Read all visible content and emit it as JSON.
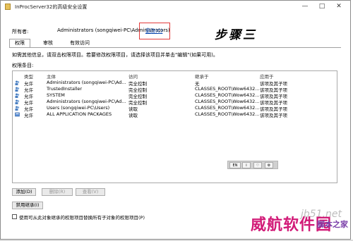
{
  "window": {
    "title": "InProcServer32的高级安全设置",
    "minimize_glyph": "—",
    "maximize_glyph": "□",
    "close_glyph": "✕"
  },
  "owner": {
    "label": "所有者:",
    "value": "Administrators (songqiwei-PC\\Administrators)",
    "change_link": "更改(C)"
  },
  "annotation": {
    "step_text": "步骤三",
    "highlight_color": "#e23a3a"
  },
  "tabs": [
    {
      "label": "权限",
      "active": true
    },
    {
      "label": "审核",
      "active": false
    },
    {
      "label": "有效访问",
      "active": false
    }
  ],
  "info_text": "如需其他信息，请双击权限项目。若要修改权限项目，请选择该项目并单击\"编辑\"(如果可用)。",
  "entries_label": "权限条目:",
  "table": {
    "headers": [
      "类型",
      "主体",
      "访问",
      "继承于",
      "应用于"
    ],
    "rows": [
      [
        "允许",
        "Administrators (songqiwei-PC\\Ad...",
        "完全控制",
        "无",
        "该项及其子项"
      ],
      [
        "允许",
        "TrustedInstaller",
        "完全控制",
        "CLASSES_ROOT\\Wow6432...",
        "该项及其子项"
      ],
      [
        "允许",
        "SYSTEM",
        "完全控制",
        "CLASSES_ROOT\\Wow6432...",
        "该项及其子项"
      ],
      [
        "允许",
        "Administrators (songqiwei-PC\\Ad...",
        "完全控制",
        "CLASSES_ROOT\\Wow6432...",
        "该项及其子项"
      ],
      [
        "允许",
        "Users (songqiwei-PC\\Users)",
        "读取",
        "CLASSES_ROOT\\Wow6432...",
        "该项及其子项"
      ],
      [
        "允许",
        "ALL APPLICATION PACKAGES",
        "读取",
        "CLASSES_ROOT\\Wow6432...",
        "该项及其子项"
      ]
    ]
  },
  "mini_toolbar": {
    "lang": "EN",
    "info": "i",
    "heart": "♡",
    "gear": "⚙"
  },
  "buttons": {
    "add": "添加(D)",
    "remove": "删除(R)",
    "view": "查看(V)",
    "disable_inheritance": "禁用继承(I)"
  },
  "checkbox_label": "使用可从此对象继承的权限项目替换所有子对象的权限项目(P)",
  "watermarks": {
    "site": "jb51.net",
    "main": "威航软件园",
    "sub": "脚本之家"
  },
  "colors": {
    "link": "#0645ad",
    "watermark_main": "#d21b78",
    "watermark_sub": "#7a3ea8"
  }
}
